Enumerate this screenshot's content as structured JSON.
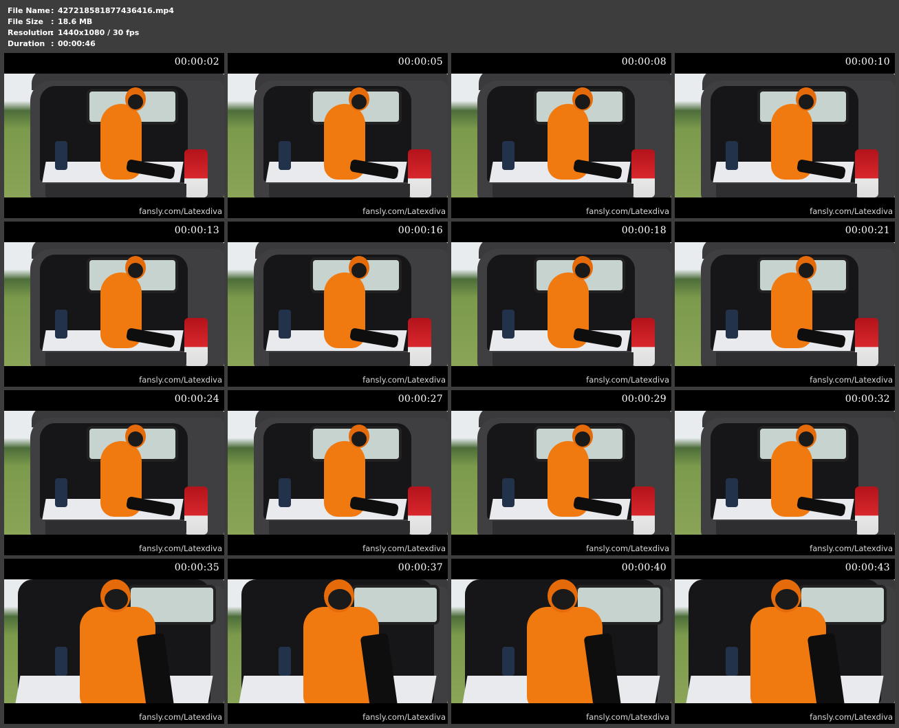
{
  "file_info": {
    "file_name_label": "File Name",
    "file_name": "427218581877436416.mp4",
    "file_size_label": "File Size",
    "file_size": "18.6 MB",
    "resolution_label": "Resolution",
    "resolution": "1440x1080 / 30 fps",
    "duration_label": "Duration",
    "duration": "00:00:46",
    "separator": ":"
  },
  "frames": [
    {
      "timestamp": "00:00:02",
      "watermark": "fansly.com/Latexdiva"
    },
    {
      "timestamp": "00:00:05",
      "watermark": "fansly.com/Latexdiva"
    },
    {
      "timestamp": "00:00:08",
      "watermark": "fansly.com/Latexdiva"
    },
    {
      "timestamp": "00:00:10",
      "watermark": "fansly.com/Latexdiva"
    },
    {
      "timestamp": "00:00:13",
      "watermark": "fansly.com/Latexdiva"
    },
    {
      "timestamp": "00:00:16",
      "watermark": "fansly.com/Latexdiva"
    },
    {
      "timestamp": "00:00:18",
      "watermark": "fansly.com/Latexdiva"
    },
    {
      "timestamp": "00:00:21",
      "watermark": "fansly.com/Latexdiva"
    },
    {
      "timestamp": "00:00:24",
      "watermark": "fansly.com/Latexdiva"
    },
    {
      "timestamp": "00:00:27",
      "watermark": "fansly.com/Latexdiva"
    },
    {
      "timestamp": "00:00:29",
      "watermark": "fansly.com/Latexdiva"
    },
    {
      "timestamp": "00:00:32",
      "watermark": "fansly.com/Latexdiva"
    },
    {
      "timestamp": "00:00:35",
      "watermark": "fansly.com/Latexdiva"
    },
    {
      "timestamp": "00:00:37",
      "watermark": "fansly.com/Latexdiva"
    },
    {
      "timestamp": "00:00:40",
      "watermark": "fansly.com/Latexdiva"
    },
    {
      "timestamp": "00:00:43",
      "watermark": "fansly.com/Latexdiva"
    }
  ],
  "colors": {
    "background": "#3d3d3d",
    "frame_border": "#000000",
    "suit_orange": "#f07a10",
    "taillight_red": "#d8272c"
  }
}
